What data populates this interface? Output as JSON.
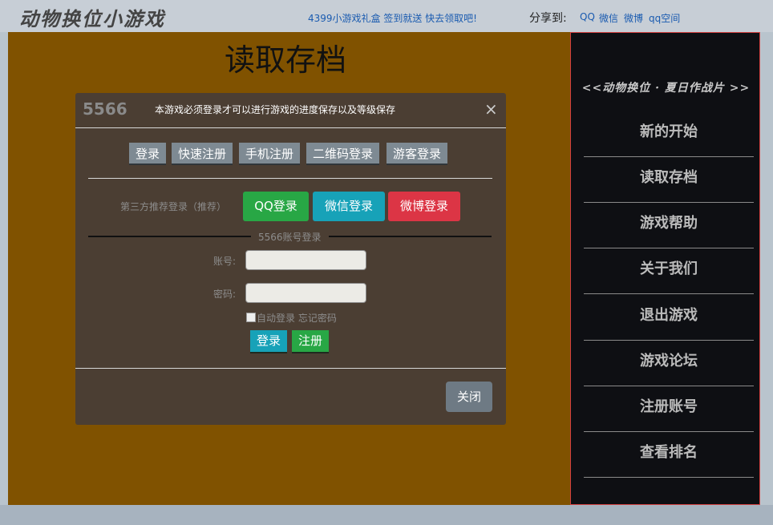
{
  "header": {
    "brand": "动物换位小游戏",
    "promo": "4399小游戏礼盒 签到就送 快去领取吧!",
    "share_label": "分享到:",
    "share_links": [
      "QQ",
      "微信",
      "微博",
      "qq空间"
    ]
  },
  "stage": {
    "title": "读取存档"
  },
  "menu": {
    "heading": "<<动物换位 · 夏日作战片 >>",
    "items": [
      "新的开始",
      "读取存档",
      "游戏帮助",
      "关于我们",
      "退出游戏",
      "游戏论坛",
      "注册账号",
      "查看排名"
    ]
  },
  "dialog": {
    "logo": "5566",
    "notice": "本游戏必须登录才可以进行游戏的进度保存以及等级保存",
    "close_icon": "×",
    "tabs": [
      "登录",
      "快速注册",
      "手机注册",
      "二维码登录",
      "游客登录"
    ],
    "third_party_label": "第三方推荐登录（推荐）",
    "social": [
      {
        "label": "QQ登录",
        "color": "#28a745"
      },
      {
        "label": "微信登录",
        "color": "#17a2b8"
      },
      {
        "label": "微博登录",
        "color": "#dc3545"
      }
    ],
    "account_section": "5566账号登录",
    "account_label": "账号:",
    "password_label": "密码:",
    "auto_login": "自动登录",
    "forgot_password": "忘记密码",
    "login_button": "登录",
    "register_button": "注册",
    "close_button": "关闭"
  },
  "colors": {
    "stage_bg": "#805200",
    "dialog_bg": "#4b3e33",
    "menu_bg": "#0e0f13"
  }
}
